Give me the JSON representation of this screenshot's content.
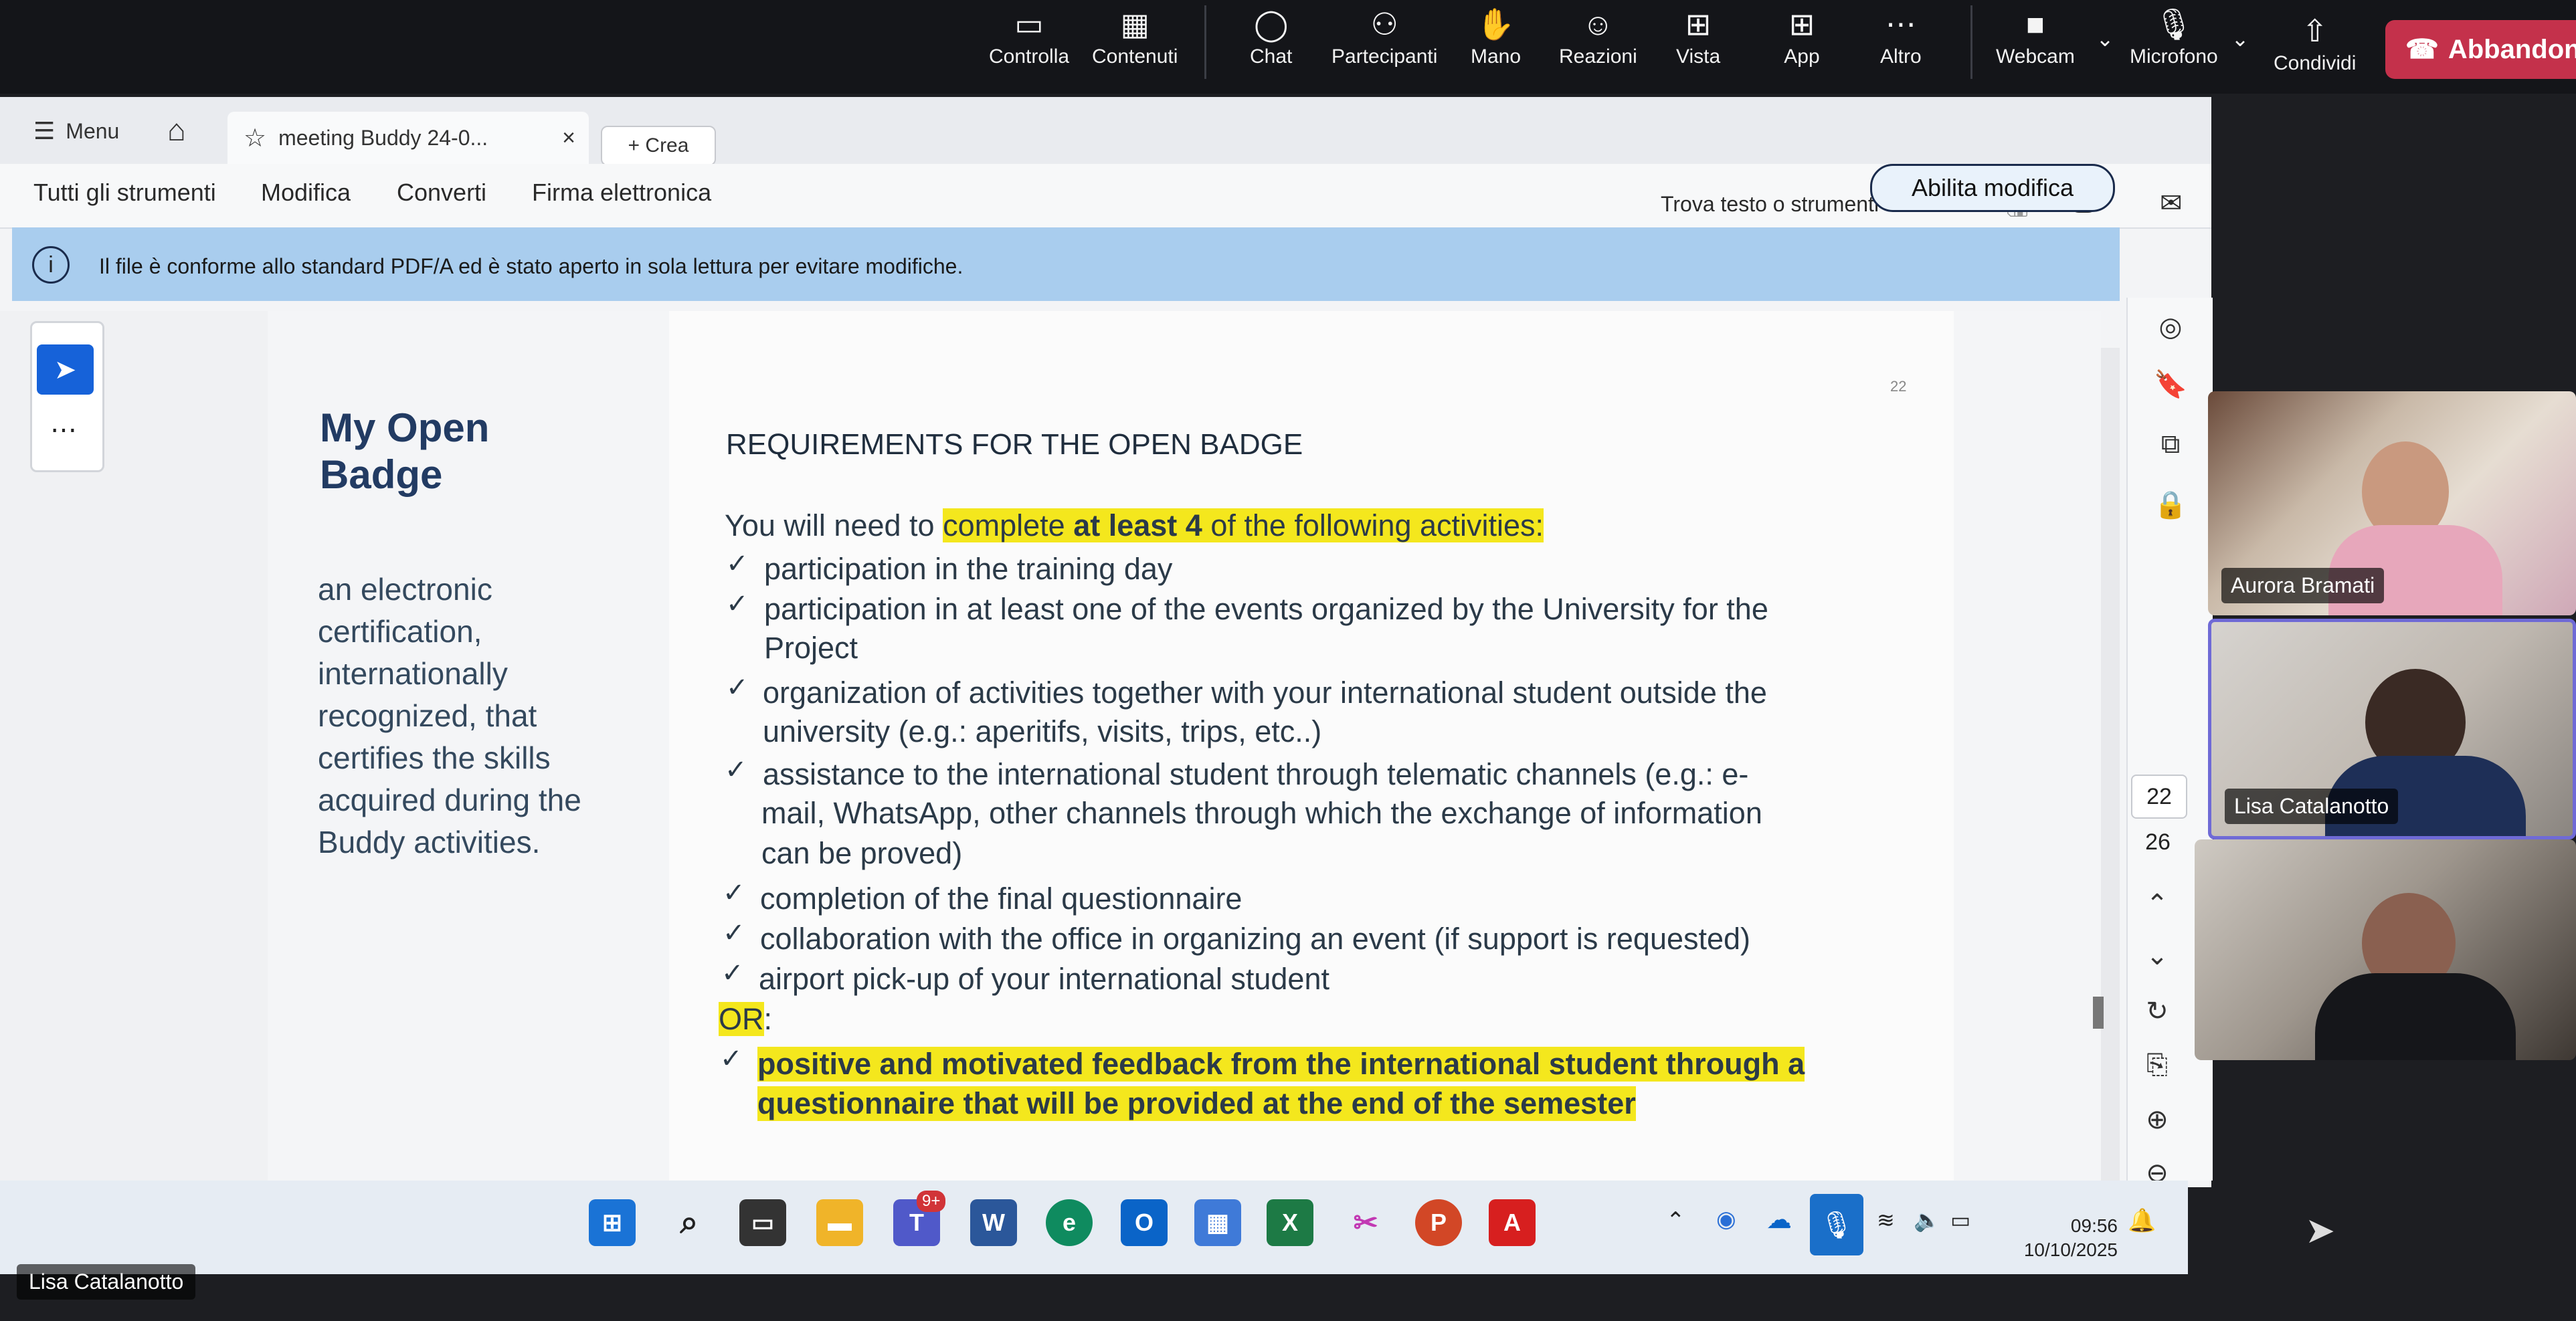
{
  "teams": {
    "items": [
      {
        "label": "Controlla",
        "icon": "controls-icon"
      },
      {
        "label": "Contenuti",
        "icon": "content-icon"
      },
      {
        "label": "Chat",
        "icon": "chat-icon"
      },
      {
        "label": "Partecipanti",
        "icon": "participants-icon"
      },
      {
        "label": "Mano",
        "icon": "raise-hand-icon"
      },
      {
        "label": "Reazioni",
        "icon": "reactions-icon"
      },
      {
        "label": "Vista",
        "icon": "view-icon"
      },
      {
        "label": "App",
        "icon": "apps-icon"
      },
      {
        "label": "Altro",
        "icon": "more-icon"
      },
      {
        "label": "Webcam",
        "icon": "camera-icon"
      },
      {
        "label": "Microfono",
        "icon": "mic-icon"
      },
      {
        "label": "Condividi",
        "icon": "share-icon"
      }
    ],
    "leave_label": "Abbandona"
  },
  "acrobat": {
    "menu_label": "Menu",
    "tab_title": "meeting Buddy 24-0...",
    "new_tab_label": "+ Crea",
    "menu_items": [
      "Tutti gli strumenti",
      "Modifica",
      "Converti",
      "Firma elettronica"
    ],
    "search_label": "Trova testo o strumenti",
    "info_text": "Il file è conforme allo standard PDF/A ed è stato aperto in sola lettura per evitare modifiche.",
    "enable_edit_label": "Abilita modifica",
    "current_page": "22",
    "total_pages": "26"
  },
  "document": {
    "page_number": "22",
    "left_title": "My Open Badge",
    "left_desc": [
      "an electronic",
      "certification,",
      "internationally",
      "recognized, that",
      "certifies the skills",
      "acquired during the",
      "Buddy activities."
    ],
    "heading": "REQUIREMENTS FOR THE OPEN BADGE",
    "intro_plain": "You will need to ",
    "intro_hl1": "complete ",
    "intro_hl_bold": "at least 4",
    "intro_hl2": " of the following activities:",
    "items": [
      [
        "participation in the training day"
      ],
      [
        "participation in at least one of the events organized by the University for the",
        "Project"
      ],
      [
        "organization of activities together with your international student outside the",
        "university (e.g.: aperitifs, visits, trips, etc..)"
      ],
      [
        "assistance to the international student through telematic channels (e.g.: e-",
        "mail, WhatsApp, other channels through which the exchange of information",
        "can be proved)"
      ],
      [
        "completion of the final questionnaire"
      ],
      [
        "collaboration with the office in organizing an event (if support is requested)"
      ],
      [
        "airport pick-up of your international student"
      ]
    ],
    "or_label": "OR",
    "or_colon": ":",
    "alt_item": [
      "positive and motivated feedback from the international student through a",
      "questionnaire that will be provided at the end of the semester"
    ]
  },
  "taskbar": {
    "time": "09:56",
    "date": "10/10/2025",
    "badge": "9+"
  },
  "participants": [
    {
      "name": "Aurora Bramati"
    },
    {
      "name": "Lisa Catalanotto"
    }
  ],
  "self_name": "Lisa Catalanotto"
}
